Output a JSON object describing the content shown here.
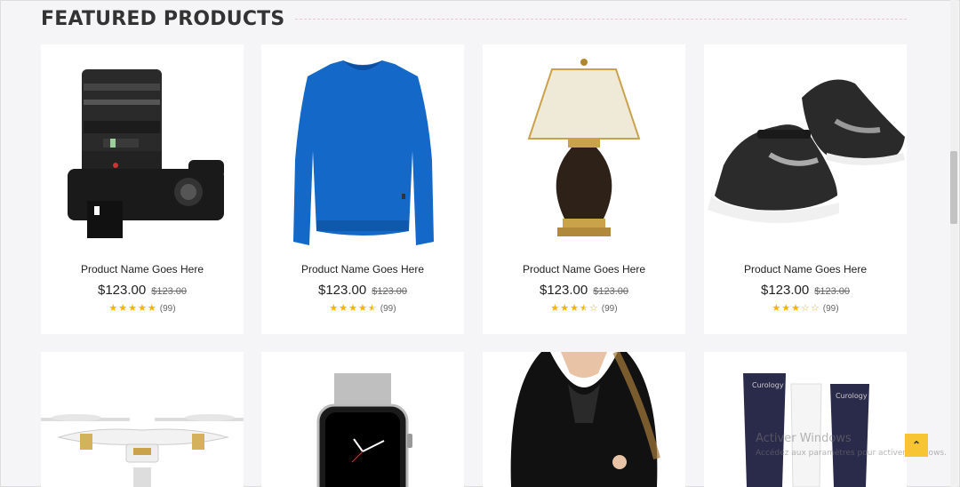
{
  "section": {
    "title": "FEATURED PRODUCTS"
  },
  "products": [
    {
      "name": "Product Name Goes Here",
      "price": "$123.00",
      "old_price": "$123.00",
      "rating": 5,
      "reviews": "(99)",
      "image": "camera"
    },
    {
      "name": "Product Name Goes Here",
      "price": "$123.00",
      "old_price": "$123.00",
      "rating": 4.5,
      "reviews": "(99)",
      "image": "sweater"
    },
    {
      "name": "Product Name Goes Here",
      "price": "$123.00",
      "old_price": "$123.00",
      "rating": 3.5,
      "reviews": "(99)",
      "image": "lamp"
    },
    {
      "name": "Product Name Goes Here",
      "price": "$123.00",
      "old_price": "$123.00",
      "rating": 3,
      "reviews": "(99)",
      "image": "sneakers"
    },
    {
      "image": "drone"
    },
    {
      "image": "smartwatch"
    },
    {
      "image": "dress"
    },
    {
      "image": "cosmetics",
      "brand_label": "Curology"
    }
  ],
  "back_to_top": {
    "icon": "double-chevron-up-icon",
    "color": "#f7c531"
  },
  "watermark": {
    "line1": "Activer Windows",
    "line2": "Accédez aux paramètres pour activer Windows."
  },
  "colors": {
    "star": "#f5b301",
    "card_bg": "#ffffff",
    "page_bg": "#f5f5f7"
  }
}
